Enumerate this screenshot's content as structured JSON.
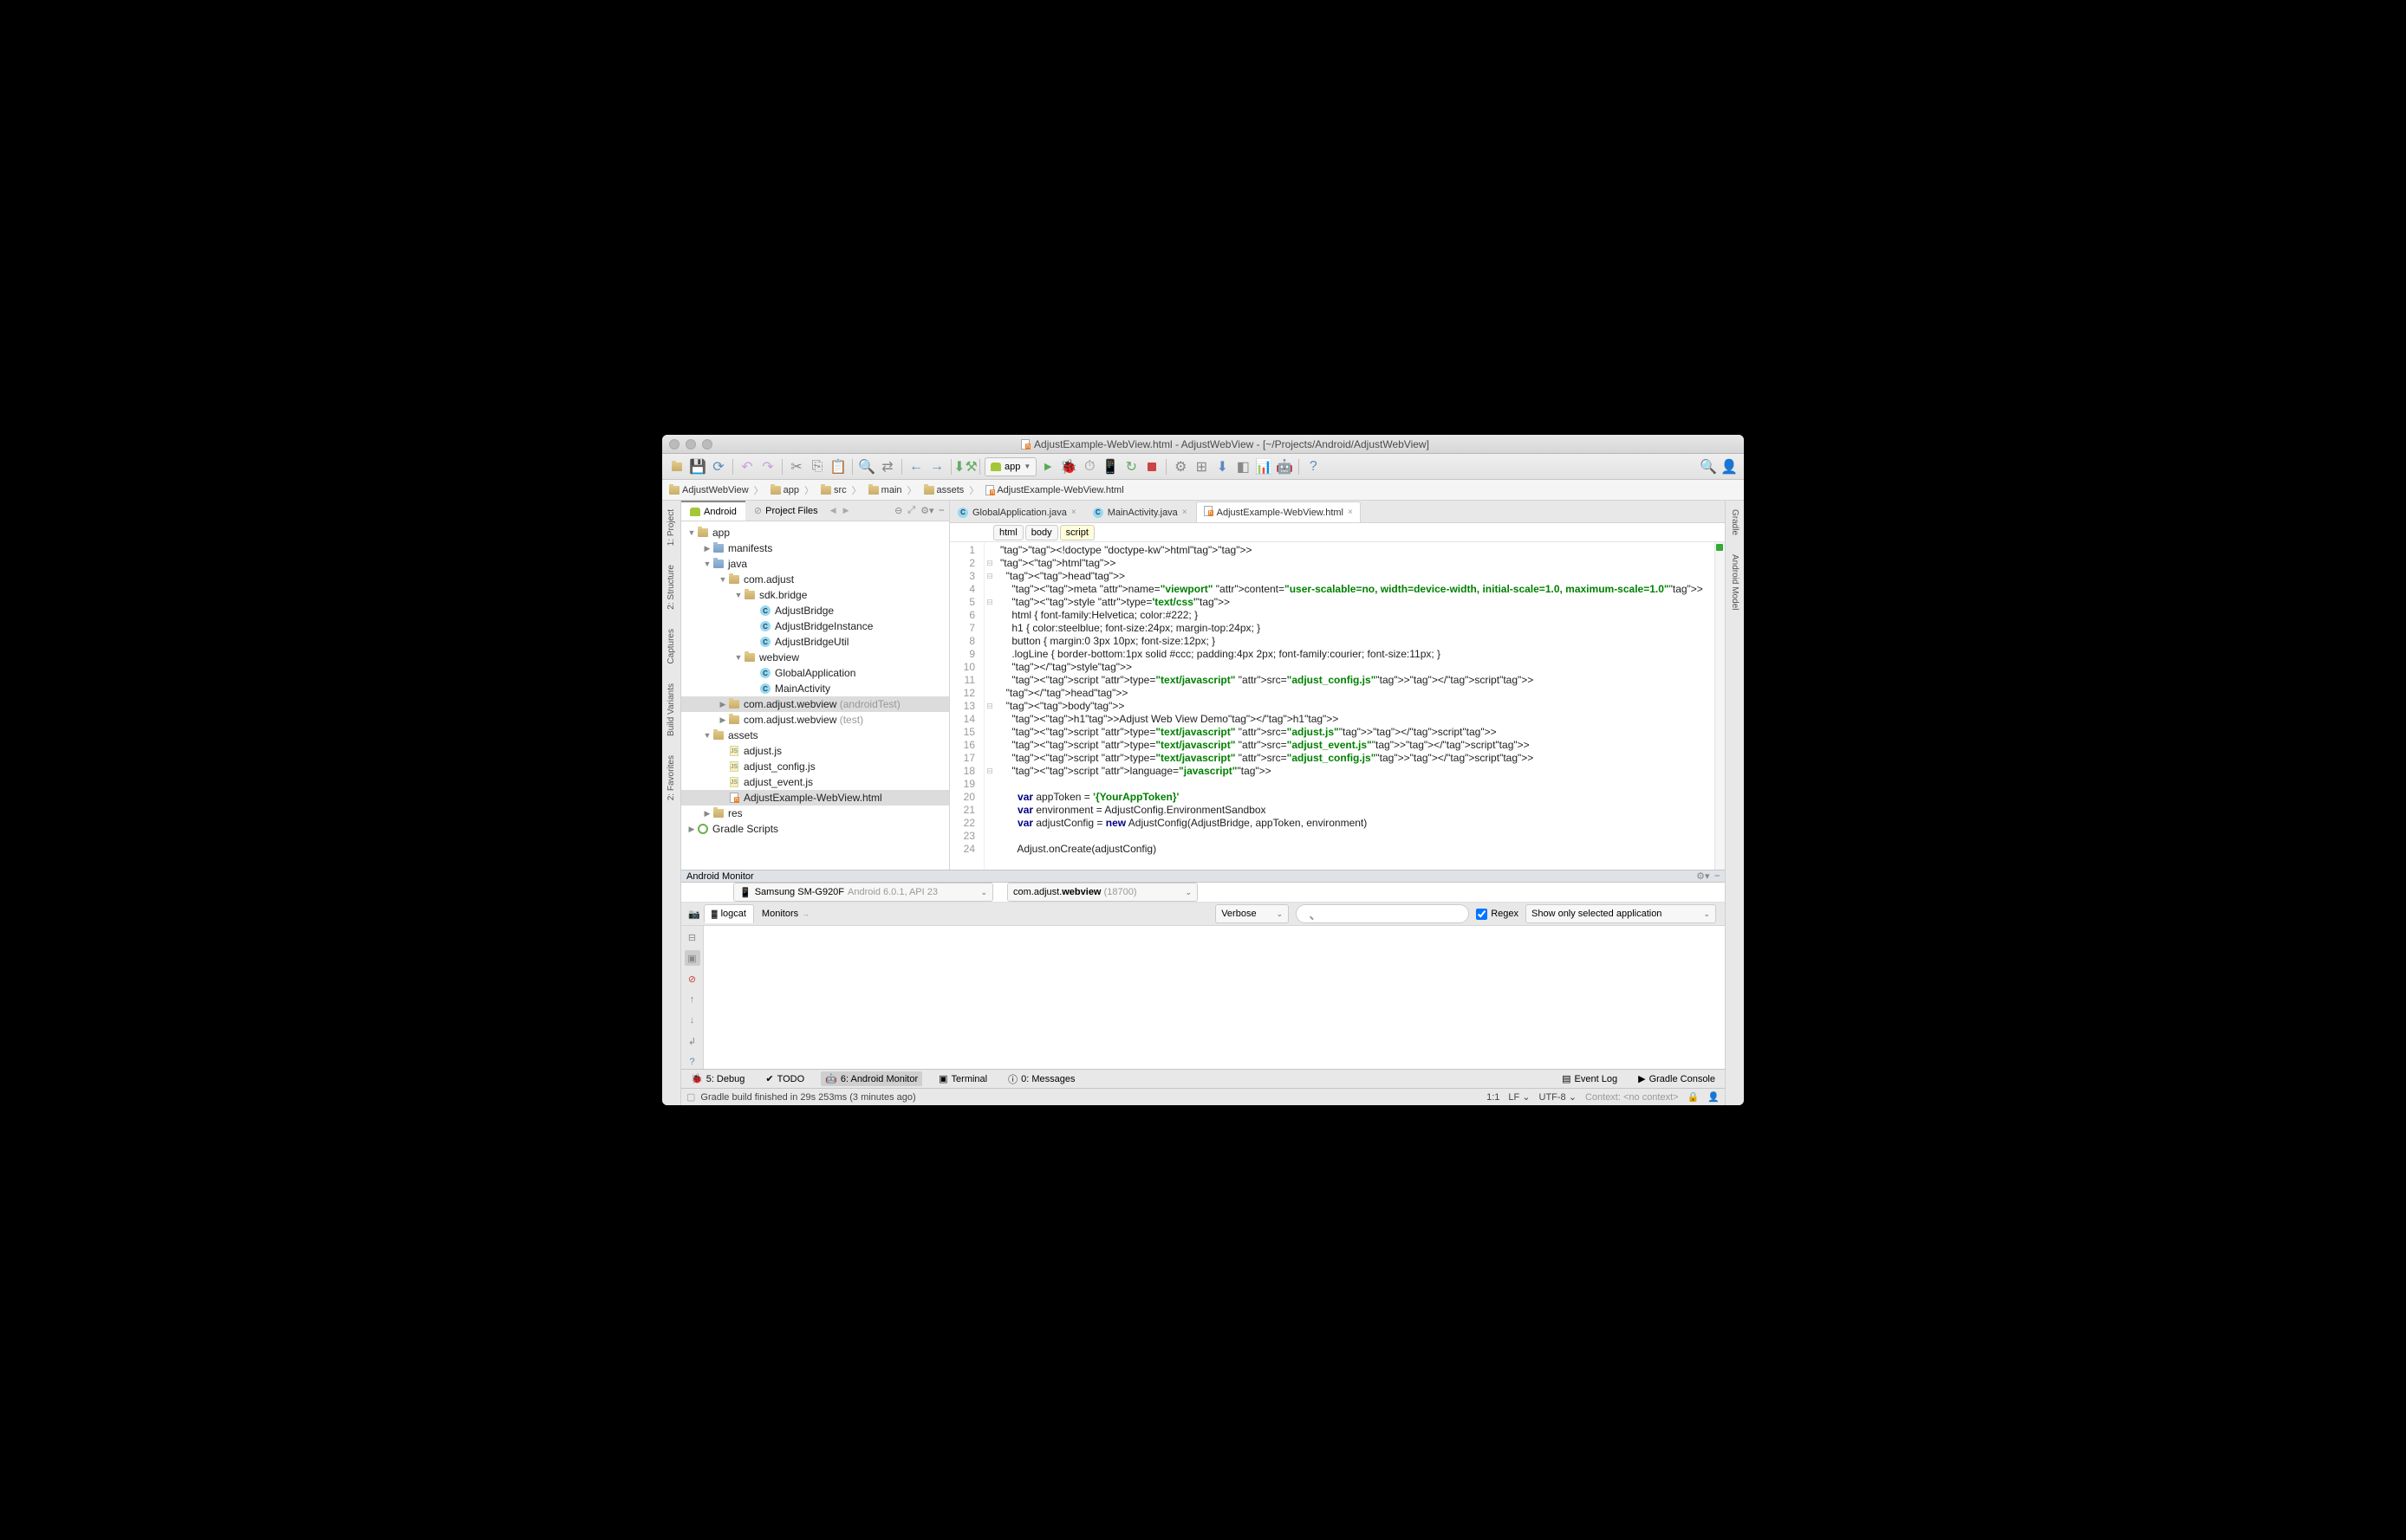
{
  "titlebar": {
    "title": "AdjustExample-WebView.html - AdjustWebView - [~/Projects/Android/AdjustWebView]"
  },
  "toolbar": {
    "module": "app"
  },
  "breadcrumb": [
    "AdjustWebView",
    "app",
    "src",
    "main",
    "assets",
    "AdjustExample-WebView.html"
  ],
  "left_stripe": [
    "1: Project",
    "2: Structure",
    "Captures",
    "Build Variants",
    "2: Favorites"
  ],
  "right_stripe": [
    "Gradle",
    "Android Model"
  ],
  "project_tabs": {
    "active": "Android",
    "other": "Project Files"
  },
  "tree": [
    {
      "d": 0,
      "arrow": "▼",
      "icon": "folder-tan",
      "label": "app",
      "sel": false
    },
    {
      "d": 1,
      "arrow": "▶",
      "icon": "folder",
      "label": "manifests"
    },
    {
      "d": 1,
      "arrow": "▼",
      "icon": "folder",
      "label": "java"
    },
    {
      "d": 2,
      "arrow": "▼",
      "icon": "folder-tan",
      "label": "com.adjust"
    },
    {
      "d": 3,
      "arrow": "▼",
      "icon": "folder-tan",
      "label": "sdk.bridge"
    },
    {
      "d": 4,
      "arrow": "",
      "icon": "java",
      "label": "AdjustBridge"
    },
    {
      "d": 4,
      "arrow": "",
      "icon": "java",
      "label": "AdjustBridgeInstance"
    },
    {
      "d": 4,
      "arrow": "",
      "icon": "java",
      "label": "AdjustBridgeUtil"
    },
    {
      "d": 3,
      "arrow": "▼",
      "icon": "folder-tan",
      "label": "webview"
    },
    {
      "d": 4,
      "arrow": "",
      "icon": "java",
      "label": "GlobalApplication"
    },
    {
      "d": 4,
      "arrow": "",
      "icon": "java",
      "label": "MainActivity"
    },
    {
      "d": 2,
      "arrow": "▶",
      "icon": "folder-tan",
      "label": "com.adjust.webview",
      "suffix": "(androidTest)",
      "sel": true
    },
    {
      "d": 2,
      "arrow": "▶",
      "icon": "folder-tan",
      "label": "com.adjust.webview",
      "suffix": "(test)"
    },
    {
      "d": 1,
      "arrow": "▼",
      "icon": "folder-tan",
      "label": "assets"
    },
    {
      "d": 2,
      "arrow": "",
      "icon": "js",
      "label": "adjust.js"
    },
    {
      "d": 2,
      "arrow": "",
      "icon": "js",
      "label": "adjust_config.js"
    },
    {
      "d": 2,
      "arrow": "",
      "icon": "js",
      "label": "adjust_event.js"
    },
    {
      "d": 2,
      "arrow": "",
      "icon": "html",
      "label": "AdjustExample-WebView.html",
      "sel": true
    },
    {
      "d": 1,
      "arrow": "▶",
      "icon": "folder-tan",
      "label": "res"
    },
    {
      "d": 0,
      "arrow": "▶",
      "icon": "gradle",
      "label": "Gradle Scripts"
    }
  ],
  "editor_tabs": [
    {
      "label": "GlobalApplication.java",
      "icon": "java",
      "active": false
    },
    {
      "label": "MainActivity.java",
      "icon": "java",
      "active": false
    },
    {
      "label": "AdjustExample-WebView.html",
      "icon": "html",
      "active": true
    }
  ],
  "editor_breadcrumb": [
    "html",
    "body",
    "script"
  ],
  "code_lines": [
    "<!doctype html>",
    "<html>",
    "  <head>",
    "    <meta name=\"viewport\" content=\"user-scalable=no, width=device-width, initial-scale=1.0, maximum-scale=1.0\">",
    "    <style type='text/css'>",
    "    html { font-family:Helvetica; color:#222; }",
    "    h1 { color:steelblue; font-size:24px; margin-top:24px; }",
    "    button { margin:0 3px 10px; font-size:12px; }",
    "    .logLine { border-bottom:1px solid #ccc; padding:4px 2px; font-family:courier; font-size:11px; }",
    "    </style>",
    "    <script type=\"text/javascript\" src=\"adjust_config.js\"></script>",
    "  </head>",
    "  <body>",
    "    <h1>Adjust Web View Demo</h1>",
    "    <script type=\"text/javascript\" src=\"adjust.js\"></script>",
    "    <script type=\"text/javascript\" src=\"adjust_event.js\"></script>",
    "    <script type=\"text/javascript\" src=\"adjust_config.js\"></script>",
    "    <script language=\"javascript\">",
    "",
    "      var appToken = '{YourAppToken}'",
    "      var environment = AdjustConfig.EnvironmentSandbox",
    "      var adjustConfig = new AdjustConfig(AdjustBridge, appToken, environment)",
    "",
    "      Adjust.onCreate(adjustConfig)"
  ],
  "monitor": {
    "title": "Android Monitor",
    "device": "Samsung SM-G920F",
    "device_suffix": "Android 6.0.1, API 23",
    "process_prefix": "com.adjust.",
    "process_bold": "webview",
    "process_pid": "(18700)",
    "tabs": [
      "logcat",
      "Monitors"
    ],
    "level": "Verbose",
    "regex_label": "Regex",
    "filter": "Show only selected application"
  },
  "bottom_bar": {
    "items_left": [
      "5: Debug",
      "TODO",
      "6: Android Monitor",
      "Terminal",
      "0: Messages"
    ],
    "items_right": [
      "Event Log",
      "Gradle Console"
    ],
    "active": "6: Android Monitor"
  },
  "status": {
    "msg": "Gradle build finished in 29s 253ms (3 minutes ago)",
    "pos": "1:1",
    "line_sep": "LF",
    "encoding": "UTF-8",
    "context": "Context: <no context>"
  }
}
